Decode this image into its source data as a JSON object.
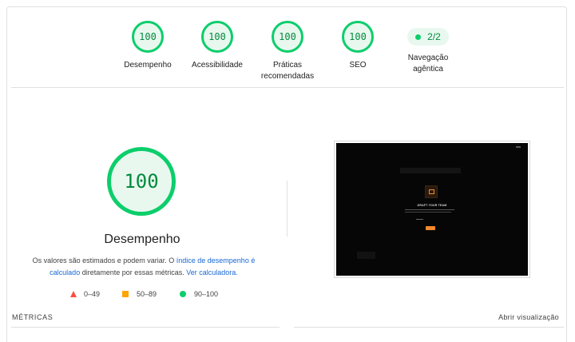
{
  "gauges": [
    {
      "score": "100",
      "label": "Desempenho"
    },
    {
      "score": "100",
      "label": "Acessibilidade"
    },
    {
      "score": "100",
      "label_line1": "Práticas",
      "label_line2": "recomendadas"
    },
    {
      "score": "100",
      "label": "SEO"
    },
    {
      "score": "2/2",
      "label_line1": "Navegação",
      "label_line2": "agêntica"
    }
  ],
  "main_gauge": {
    "score": "100",
    "title": "Desempenho",
    "desc_part1": "Os valores são estimados e podem variar. O ",
    "desc_link1": "índice de desempenho é calculado",
    "desc_part2": " diretamente por essas métricas. ",
    "desc_link2": "Ver calculadora."
  },
  "legend": {
    "fail": "0–49",
    "average": "50–89",
    "pass": "90–100"
  },
  "metrics_header": "MÉTRICAS",
  "open_view": "Abrir visualização",
  "screenshot": {
    "title": "DRAFT YOUR TEAM"
  },
  "colors": {
    "pass": "#0cce6b",
    "pass_bg": "#e9f8ef",
    "pass_text": "#008a3c",
    "average": "#ffa400",
    "fail": "#ff4e42",
    "link": "#1967d2"
  }
}
